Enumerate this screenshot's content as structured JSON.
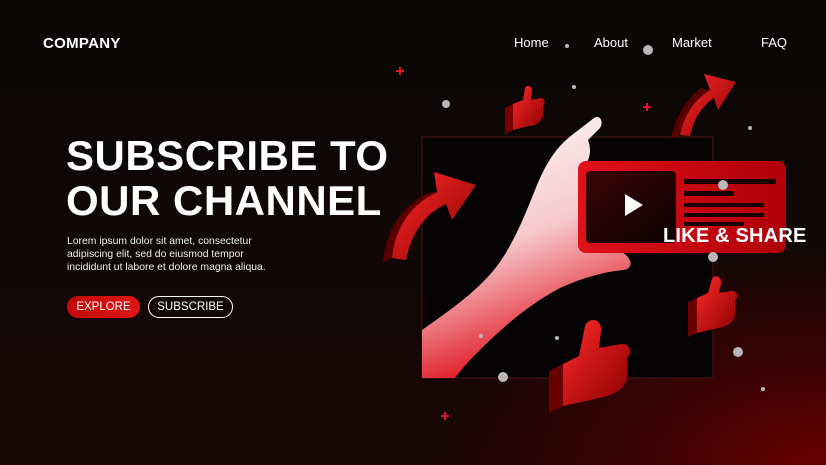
{
  "header": {
    "logo": "COMPANY",
    "nav": [
      "Home",
      "About",
      "Market",
      "FAQ"
    ]
  },
  "hero": {
    "title_line1": "SUBSCRIBE TO",
    "title_line2": "OUR CHANNEL",
    "body_line1": "Lorem ipsum dolor sit amet, consectetur",
    "body_line2": "adipiscing elit, sed do eiusmod tempor",
    "body_line3": "incididunt ut labore et dolore magna aliqua.",
    "explore_label": "EXPLORE",
    "subscribe_label": "SUBSCRIBE"
  },
  "illustration": {
    "tagline": "LIKE & SHARE",
    "icons": [
      "play-icon",
      "thumbs-up-icon",
      "arrow-icon",
      "plus-icon"
    ]
  },
  "colors": {
    "background": "#0c0707",
    "accent": "#e01515",
    "text": "#ffffff"
  }
}
